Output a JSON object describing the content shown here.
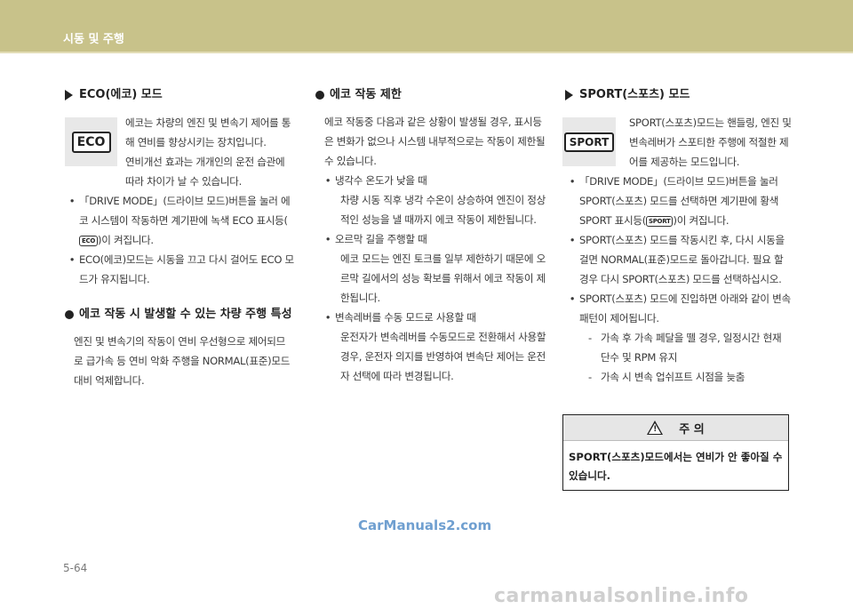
{
  "header": {
    "title": "시동 및 주행"
  },
  "eco": {
    "title": "ECO(에코) 모드",
    "badge": "ECO",
    "p1": "에코는 차량의 엔진 및 변속기 제어를 통해 연비를 향상시키는 장치입니다.",
    "p2": "연비개선 효과는 개개인의 운전 습관에 따라 차이가 날 수 있습니다.",
    "b1_pre": "「DRIVE MODE」(드라이브 모드)버튼을 눌러 에코 시스템이 작동하면 계기판에 녹색 ECO 표시등(",
    "b1_badge": "ECO",
    "b1_post": ")이 켜집니다.",
    "b2": "ECO(에코)모드는 시동을 끄고 다시 걸어도 ECO 모드가 유지됩니다."
  },
  "sec2": {
    "title": "에코 작동 시 발생할 수 있는 차량 주행 특성",
    "p": "엔진 및 변속기의 작동이 연비 우선형으로 제어되므로 급가속 등 연비 악화 주행을 NORMAL(표준)모드 대비 억제합니다."
  },
  "limit": {
    "title": "에코 작동 제한",
    "intro": "에코 작동중 다음과 같은 상황이 발생될 경우, 표시등은 변화가 없으나 시스템 내부적으로는 작동이 제한될 수 있습니다.",
    "items": [
      {
        "head": "냉각수 온도가 낮을 때",
        "body": "차량 시동 직후 냉각 수온이 상승하여 엔진이 정상적인 성능을 낼 때까지 에코 작동이 제한됩니다."
      },
      {
        "head": "오르막 길을 주행할 때",
        "body": "에코 모드는 엔진 토크를 일부 제한하기 때문에 오르막 길에서의 성능 확보를 위해서 에코 작동이 제한됩니다."
      },
      {
        "head": "변속레버를 수동 모드로 사용할 때",
        "body": "운전자가 변속레버를 수동모드로 전환해서 사용할 경우, 운전자 의지를 반영하여 변속단 제어는 운전자 선택에 따라 변경됩니다."
      }
    ]
  },
  "sport": {
    "title": "SPORT(스포츠) 모드",
    "badge": "SPORT",
    "p1": "SPORT(스포츠)모드는 핸들링, 엔진 및 변속레버가 스포티한 주행에 적절한 제어를 제공하는 모드입니다.",
    "b1_pre": "「DRIVE MODE」(드라이브 모드)버튼을 눌러 SPORT(스포츠) 모드를 선택하면 계기판에 황색 SPORT 표시등(",
    "b1_badge": "SPORT",
    "b1_post": ")이 켜집니다.",
    "b2": "SPORT(스포츠) 모드를 작동시킨 후, 다시 시동을 걸면 NORMAL(표준)모드로 돌아갑니다. 필요 할 경우 다시 SPORT(스포츠) 모드를 선택하십시오.",
    "b3": "SPORT(스포츠) 모드에 진입하면 아래와 같이 변속패턴이 제어됩니다.",
    "d1": "가속 후 가속 페달을 뗄 경우, 일정시간 현재 단수 및 RPM 유지",
    "d2": "가속 시 변속 업쉬프트 시점을 늦춤"
  },
  "caution": {
    "title": "주 의",
    "icon_text": "!",
    "body": "SPORT(스포츠)모드에서는 연비가 안 좋아질 수 있습니다."
  },
  "watermark": "CarManuals2.com",
  "page_number": "5-64",
  "footer_mark": "carmanualsonline.info"
}
